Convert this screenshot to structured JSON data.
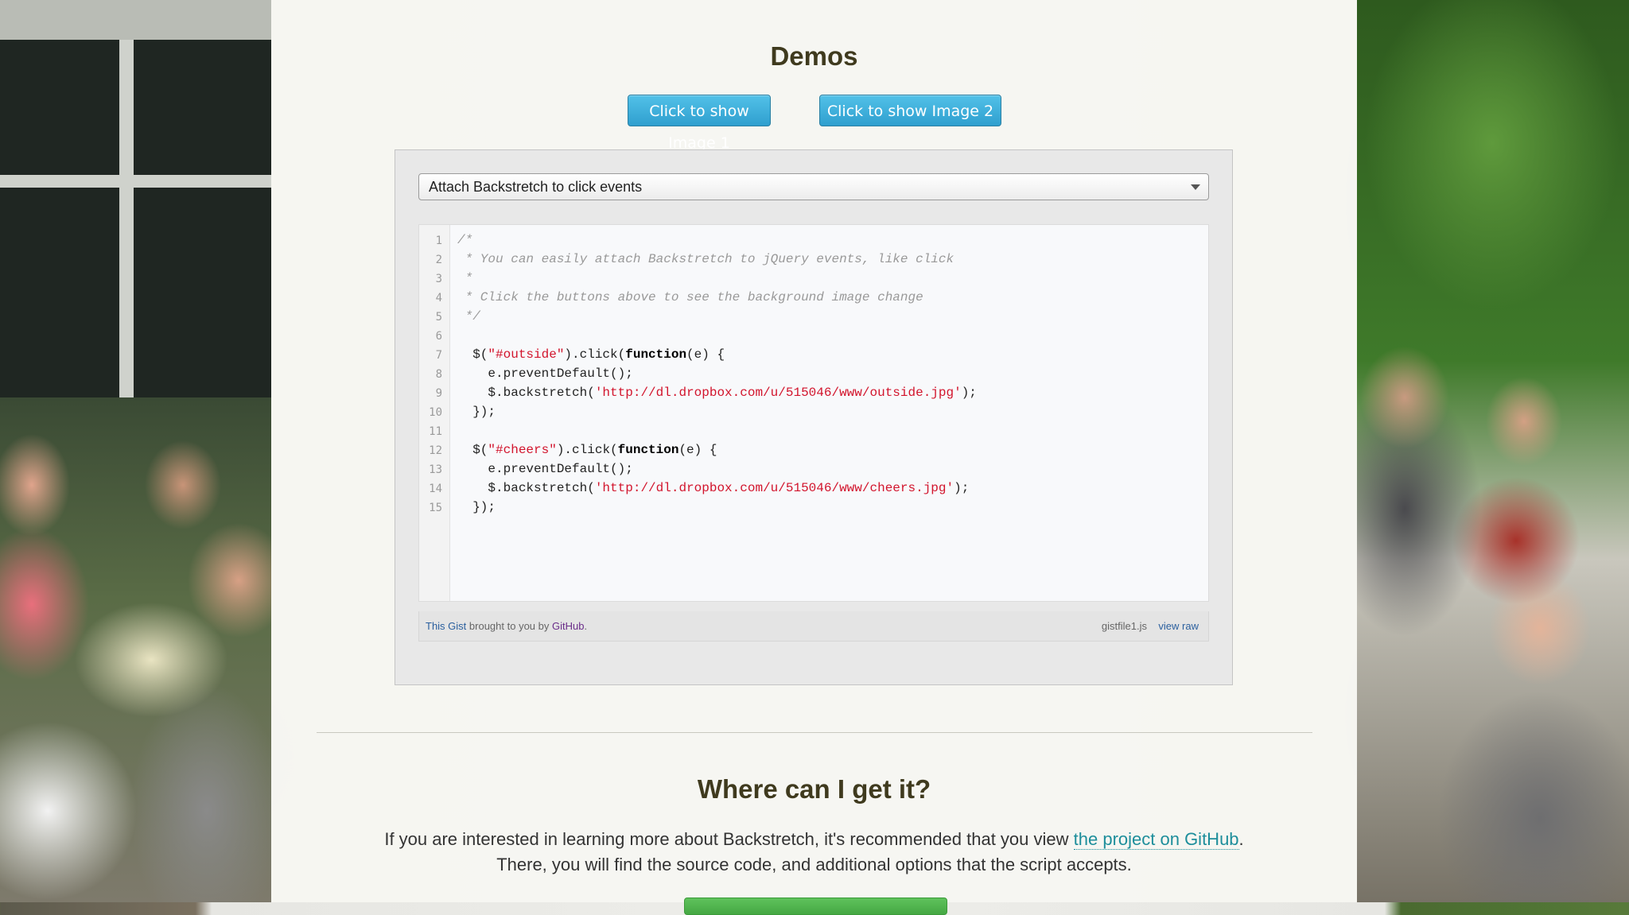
{
  "demos": {
    "heading": "Demos",
    "button1_label": "Click to show Image 1",
    "button2_label": "Click to show Image 2"
  },
  "gist": {
    "select_value": "Attach Backstretch to click events",
    "lines": [
      {
        "n": "1",
        "parts": [
          {
            "t": "/*",
            "c": "cm"
          }
        ]
      },
      {
        "n": "2",
        "parts": [
          {
            "t": " * You can easily attach Backstretch to jQuery events, like click",
            "c": "cm"
          }
        ]
      },
      {
        "n": "3",
        "parts": [
          {
            "t": " *",
            "c": "cm"
          }
        ]
      },
      {
        "n": "4",
        "parts": [
          {
            "t": " * Click the buttons above to see the background image change",
            "c": "cm"
          }
        ]
      },
      {
        "n": "5",
        "parts": [
          {
            "t": " */",
            "c": "cm"
          }
        ]
      },
      {
        "n": "6",
        "parts": []
      },
      {
        "n": "7",
        "parts": [
          {
            "t": "  $(",
            "c": ""
          },
          {
            "t": "\"#outside\"",
            "c": "st"
          },
          {
            "t": ").click(",
            "c": ""
          },
          {
            "t": "function",
            "c": "kw"
          },
          {
            "t": "(e) {",
            "c": ""
          }
        ]
      },
      {
        "n": "8",
        "parts": [
          {
            "t": "    e.preventDefault();",
            "c": ""
          }
        ]
      },
      {
        "n": "9",
        "parts": [
          {
            "t": "    $.backstretch(",
            "c": ""
          },
          {
            "t": "'http://dl.dropbox.com/u/515046/www/outside.jpg'",
            "c": "st"
          },
          {
            "t": ");",
            "c": ""
          }
        ]
      },
      {
        "n": "10",
        "parts": [
          {
            "t": "  });",
            "c": ""
          }
        ]
      },
      {
        "n": "11",
        "parts": []
      },
      {
        "n": "12",
        "parts": [
          {
            "t": "  $(",
            "c": ""
          },
          {
            "t": "\"#cheers\"",
            "c": "st"
          },
          {
            "t": ").click(",
            "c": ""
          },
          {
            "t": "function",
            "c": "kw"
          },
          {
            "t": "(e) {",
            "c": ""
          }
        ]
      },
      {
        "n": "13",
        "parts": [
          {
            "t": "    e.preventDefault();",
            "c": ""
          }
        ]
      },
      {
        "n": "14",
        "parts": [
          {
            "t": "    $.backstretch(",
            "c": ""
          },
          {
            "t": "'http://dl.dropbox.com/u/515046/www/cheers.jpg'",
            "c": "st"
          },
          {
            "t": ");",
            "c": ""
          }
        ]
      },
      {
        "n": "15",
        "parts": [
          {
            "t": "  });",
            "c": ""
          }
        ]
      }
    ],
    "footer": {
      "this_gist": "This Gist",
      "brought": " brought to you by ",
      "github": "GitHub",
      "period": ".",
      "filename": "gistfile1.js",
      "view_raw": "view raw"
    }
  },
  "where": {
    "heading": "Where can I get it?",
    "para_line1_before": "If you are interested in learning more about Backstretch, it's recommended that you view ",
    "para_link": "the project on GitHub",
    "para_line1_after": ".",
    "para_line2": "There, you will find the source code, and additional options that the script accepts."
  },
  "colors": {
    "heading": "#3f3a1e",
    "button": "#3aa9d8",
    "string": "#d2142c",
    "link": "#1d8e9b"
  }
}
